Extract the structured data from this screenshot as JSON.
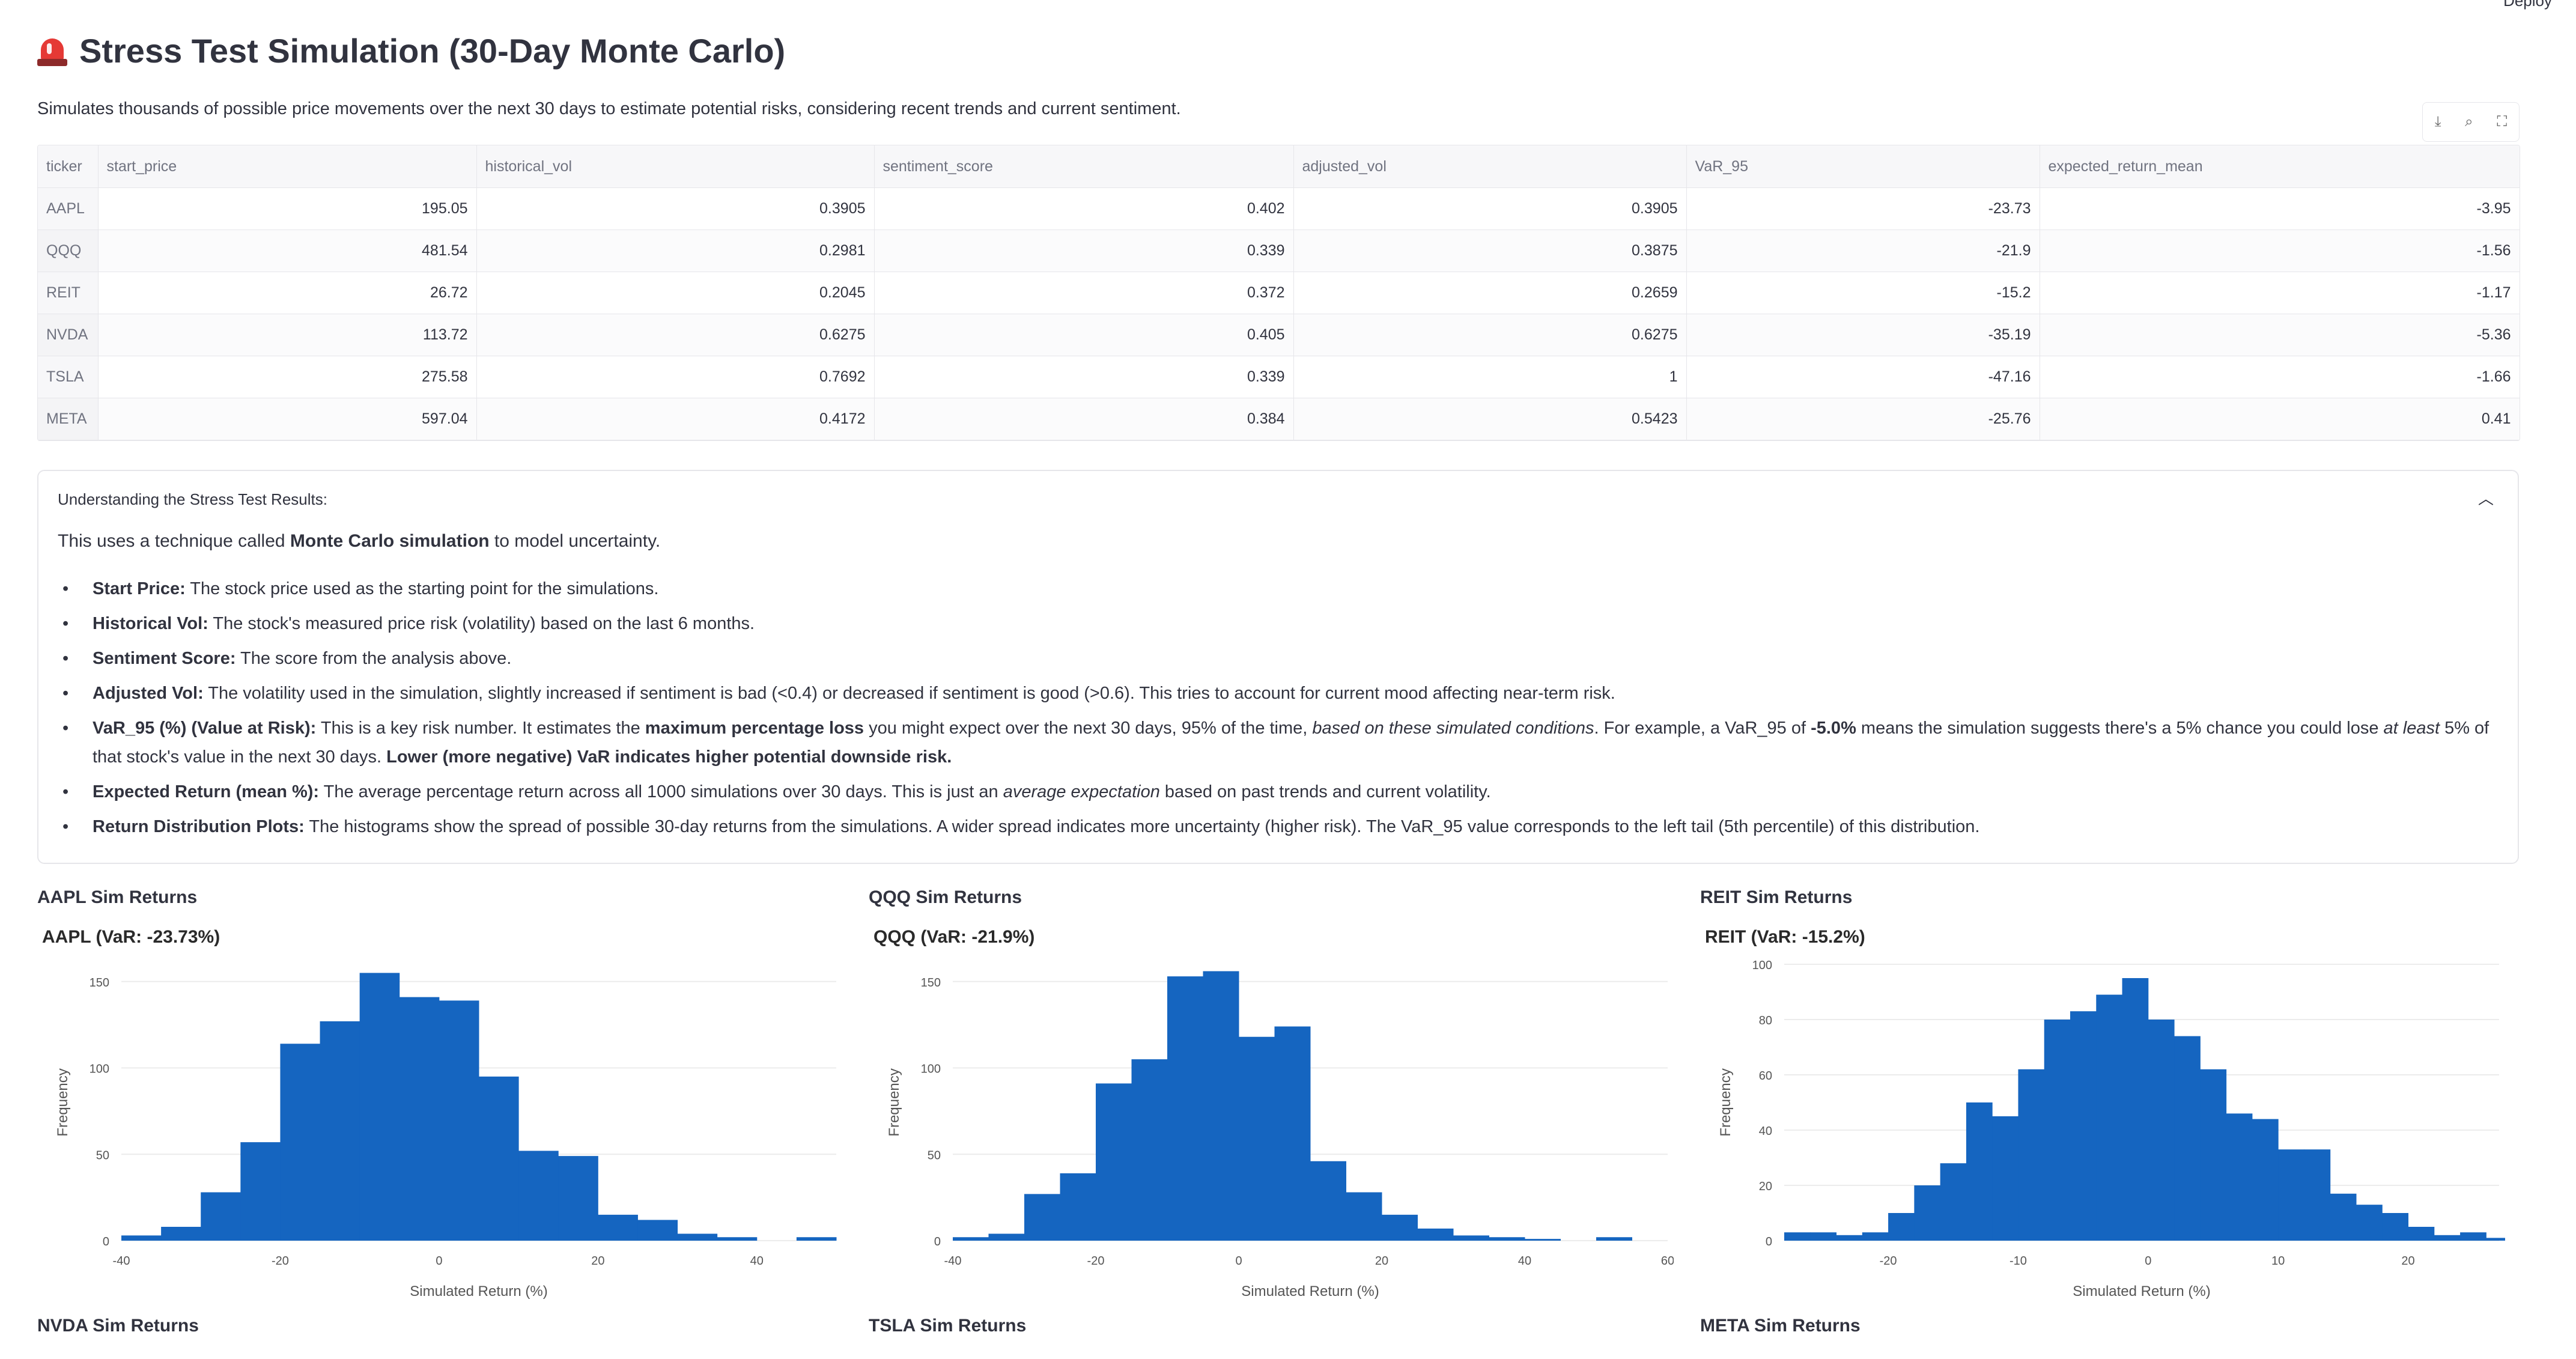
{
  "header": {
    "deploy_label": "Deploy",
    "title": "Stress Test Simulation (30-Day Monte Carlo)",
    "subtitle": "Simulates thousands of possible price movements over the next 30 days to estimate potential risks, considering recent trends and current sentiment."
  },
  "toolbar": {
    "icons": [
      "download-icon",
      "search-icon",
      "fullscreen-icon"
    ]
  },
  "table": {
    "columns": [
      "ticker",
      "start_price",
      "historical_vol",
      "sentiment_score",
      "adjusted_vol",
      "VaR_95",
      "expected_return_mean"
    ],
    "rows": [
      [
        "AAPL",
        "195.05",
        "0.3905",
        "0.402",
        "0.3905",
        "-23.73",
        "-3.95"
      ],
      [
        "QQQ",
        "481.54",
        "0.2981",
        "0.339",
        "0.3875",
        "-21.9",
        "-1.56"
      ],
      [
        "REIT",
        "26.72",
        "0.2045",
        "0.372",
        "0.2659",
        "-15.2",
        "-1.17"
      ],
      [
        "NVDA",
        "113.72",
        "0.6275",
        "0.405",
        "0.6275",
        "-35.19",
        "-5.36"
      ],
      [
        "TSLA",
        "275.58",
        "0.7692",
        "0.339",
        "1",
        "-47.16",
        "-1.66"
      ],
      [
        "META",
        "597.04",
        "0.4172",
        "0.384",
        "0.5423",
        "-25.76",
        "0.41"
      ]
    ]
  },
  "expander": {
    "label": "Understanding the Stress Test Results:",
    "intro_pre": "This uses a technique called ",
    "intro_bold": "Monte Carlo simulation",
    "intro_post": " to model uncertainty.",
    "items": [
      {
        "bold": "Start Price:",
        "text": " The stock price used as the starting point for the simulations."
      },
      {
        "bold": "Historical Vol:",
        "text": " The stock's measured price risk (volatility) based on the last 6 months."
      },
      {
        "bold": "Sentiment Score:",
        "text": " The score from the analysis above."
      },
      {
        "bold": "Adjusted Vol:",
        "text": " The volatility used in the simulation, slightly increased if sentiment is bad (<0.4) or decreased if sentiment is good (>0.6). This tries to account for current mood affecting near-term risk."
      },
      {
        "bold": "VaR_95 (%) (Value at Risk):",
        "p1": " This is a key risk number. It estimates the ",
        "b2": "maximum percentage loss",
        "p2": " you might expect over the next 30 days, 95% of the time, ",
        "i1": "based on these simulated conditions",
        "p3": ". For example, a VaR_95 of ",
        "b3": "-5.0%",
        "p4": " means the simulation suggests there's a 5% chance you could lose ",
        "i2": "at least",
        "p5": " 5% of that stock's value in the next 30 days. ",
        "b4": "Lower (more negative) VaR indicates higher potential downside risk."
      },
      {
        "bold": "Expected Return (mean %):",
        "p1": " The average percentage return across all 1000 simulations over 30 days. This is just an ",
        "i1": "average expectation",
        "p2": " based on past trends and current volatility."
      },
      {
        "bold": "Return Distribution Plots:",
        "text": " The histograms show the spread of possible 30-day returns from the simulations. A wider spread indicates more uncertainty (higher risk). The VaR_95 value corresponds to the left tail (5th percentile) of this distribution."
      }
    ]
  },
  "charts_row2_titles": [
    "NVDA Sim Returns",
    "TSLA Sim Returns",
    "META Sim Returns"
  ],
  "chart_data": [
    {
      "type": "bar",
      "panel_title": "AAPL Sim Returns",
      "title": "AAPL (VaR: -23.73%)",
      "xlabel": "Simulated Return (%)",
      "ylabel": "Frequency",
      "bin_start": -40,
      "bin_width": 5,
      "values": [
        3,
        8,
        28,
        57,
        114,
        127,
        155,
        141,
        139,
        95,
        52,
        49,
        15,
        12,
        4,
        2,
        0,
        2
      ],
      "xlim": [
        -40,
        50
      ],
      "ylim": [
        0,
        160
      ],
      "xticks": [
        -40,
        -20,
        0,
        20,
        40
      ],
      "yticks": [
        0,
        50,
        100,
        150
      ],
      "bar_color": "#1565c0"
    },
    {
      "type": "bar",
      "panel_title": "QQQ Sim Returns",
      "title": "QQQ (VaR: -21.9%)",
      "xlabel": "Simulated Return (%)",
      "ylabel": "Frequency",
      "bin_start": -40,
      "bin_width": 5,
      "values": [
        2,
        4,
        27,
        39,
        91,
        105,
        153,
        156,
        118,
        124,
        46,
        28,
        15,
        7,
        3,
        2,
        1,
        0,
        2
      ],
      "xlim": [
        -40,
        60
      ],
      "ylim": [
        0,
        160
      ],
      "xticks": [
        -40,
        -20,
        0,
        20,
        40,
        60
      ],
      "yticks": [
        0,
        50,
        100,
        150
      ],
      "bar_color": "#1565c0"
    },
    {
      "type": "bar",
      "panel_title": "REIT Sim Returns",
      "title": "REIT (VaR: -15.2%)",
      "xlabel": "Simulated Return (%)",
      "ylabel": "Frequency",
      "bin_start": -28,
      "bin_width": 2,
      "values": [
        3,
        3,
        2,
        3,
        10,
        20,
        28,
        50,
        45,
        62,
        80,
        83,
        89,
        95,
        80,
        74,
        62,
        46,
        44,
        33,
        33,
        17,
        13,
        10,
        5,
        2,
        3,
        1
      ],
      "xlim": [
        -28,
        27
      ],
      "ylim": [
        0,
        100
      ],
      "xticks": [
        -20,
        -10,
        0,
        10,
        20
      ],
      "yticks": [
        0,
        20,
        40,
        60,
        80,
        100
      ],
      "bar_color": "#1565c0"
    }
  ]
}
